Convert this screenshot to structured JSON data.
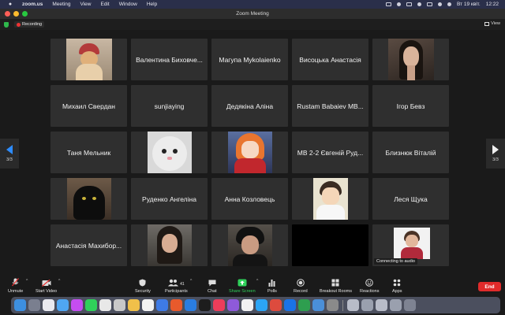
{
  "menubar": {
    "app_name": "zoom.us",
    "items": [
      "Meeting",
      "View",
      "Edit",
      "Window",
      "Help"
    ],
    "datetime": "Вт 19 квіт.",
    "time": "12:22"
  },
  "window": {
    "title": "Zoom Meeting"
  },
  "status": {
    "recording_label": "Recording",
    "view_label": "View"
  },
  "gallery": {
    "page_left": "3/3",
    "page_right": "3/3",
    "participants": [
      {
        "name": "",
        "photo": "cat-hat"
      },
      {
        "name": "Валентина Биховче..."
      },
      {
        "name": "Магупа Mykolaienko"
      },
      {
        "name": "Висоцька Анастасія"
      },
      {
        "name": "",
        "photo": "woman-dark-hair"
      },
      {
        "name": "Михаил Свердан"
      },
      {
        "name": "sunjiaying"
      },
      {
        "name": "Дедякіна Аліна"
      },
      {
        "name": "Rustam Babaiev MB..."
      },
      {
        "name": "Ігор Бевз"
      },
      {
        "name": "Таня Мельник"
      },
      {
        "name": "",
        "photo": "cat-face"
      },
      {
        "name": "",
        "photo": "anime"
      },
      {
        "name": "МВ 2-2 Євгеній Руд..."
      },
      {
        "name": "Близнюк Віталій"
      },
      {
        "name": "",
        "photo": "black-cat"
      },
      {
        "name": "Руденко Ангеліна"
      },
      {
        "name": "Анна Козловець"
      },
      {
        "name": "",
        "photo": "anime-boy"
      },
      {
        "name": "Леся Щука"
      },
      {
        "name": "Анастасія Махибор..."
      },
      {
        "name": "",
        "photo": "woman-2"
      },
      {
        "name": "",
        "photo": "woman-3"
      },
      {
        "name": "",
        "photo": "black"
      },
      {
        "name": "",
        "photo": "woman-4",
        "status": "Connecting to audio"
      }
    ]
  },
  "toolbar": {
    "unmute": "Unmute",
    "start_video": "Start Video",
    "security": "Security",
    "participants": "Participants",
    "participants_count": "41",
    "chat": "Chat",
    "share_screen": "Share Screen",
    "polls": "Polls",
    "record": "Record",
    "breakout_rooms": "Breakout Rooms",
    "reactions": "Reactions",
    "apps": "Apps",
    "end": "End"
  },
  "colors": {
    "accent_green": "#2fd15a",
    "end_red": "#e02b2b",
    "nav_blue": "#2d8cff",
    "recording_red": "#e33333"
  }
}
